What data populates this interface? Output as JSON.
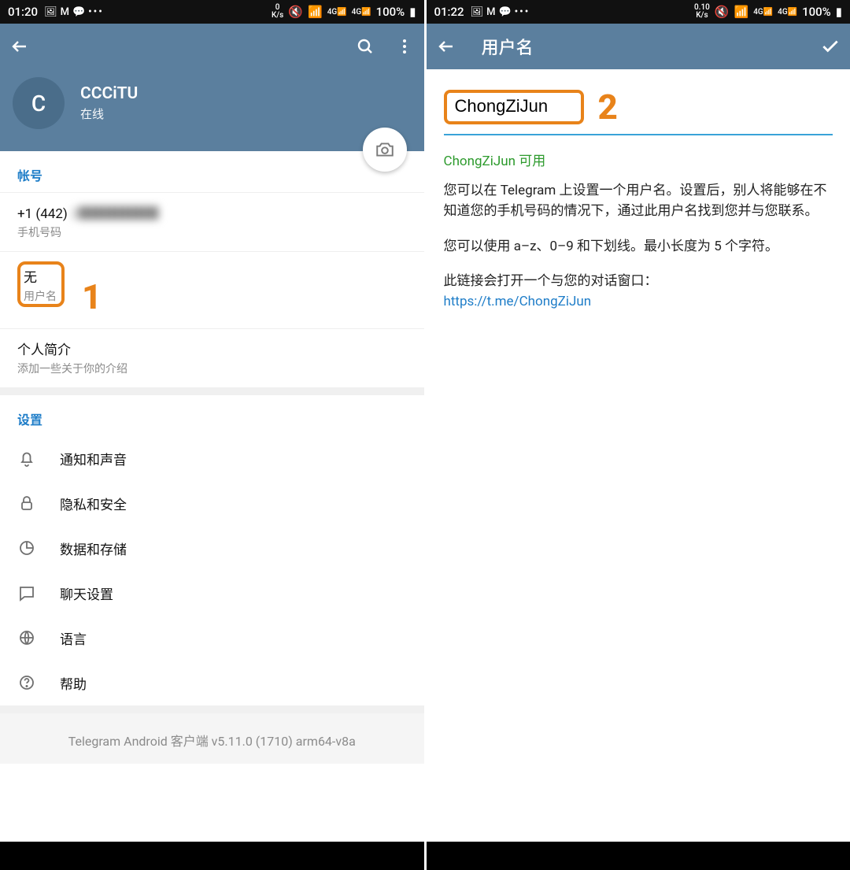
{
  "left": {
    "status": {
      "time": "01:20",
      "net": "0",
      "net_unit": "K/s",
      "battery": "100%"
    },
    "profile": {
      "initial": "C",
      "name": "CCCiTU",
      "status": "在线"
    },
    "account": {
      "header": "帐号",
      "phone_prefix": "+1 (442)",
      "phone_rest": "2██████",
      "phone_label": "手机号码",
      "username_value": "无",
      "username_label": "用户名",
      "bio_title": "个人简介",
      "bio_hint": "添加一些关于你的介绍"
    },
    "settings": {
      "header": "设置",
      "items": [
        "通知和声音",
        "隐私和安全",
        "数据和存储",
        "聊天设置",
        "语言",
        "帮助"
      ]
    },
    "footer": "Telegram Android 客户端 v5.11.0 (1710) arm64-v8a",
    "annotation": "1"
  },
  "right": {
    "status": {
      "time": "01:22",
      "net": "0.10",
      "net_unit": "K/s",
      "battery": "100%"
    },
    "title": "用户名",
    "username": "ChongZiJun",
    "available": "ChongZiJun 可用",
    "desc1": "您可以在 Telegram 上设置一个用户名。设置后，别人将能够在不知道您的手机号码的情况下，通过此用户名找到您并与您联系。",
    "desc2": "您可以使用 a–z、0–9 和下划线。最小长度为 5 个字符。",
    "desc3": "此链接会打开一个与您的对话窗口：",
    "link": "https://t.me/ChongZiJun",
    "annotation": "2"
  }
}
